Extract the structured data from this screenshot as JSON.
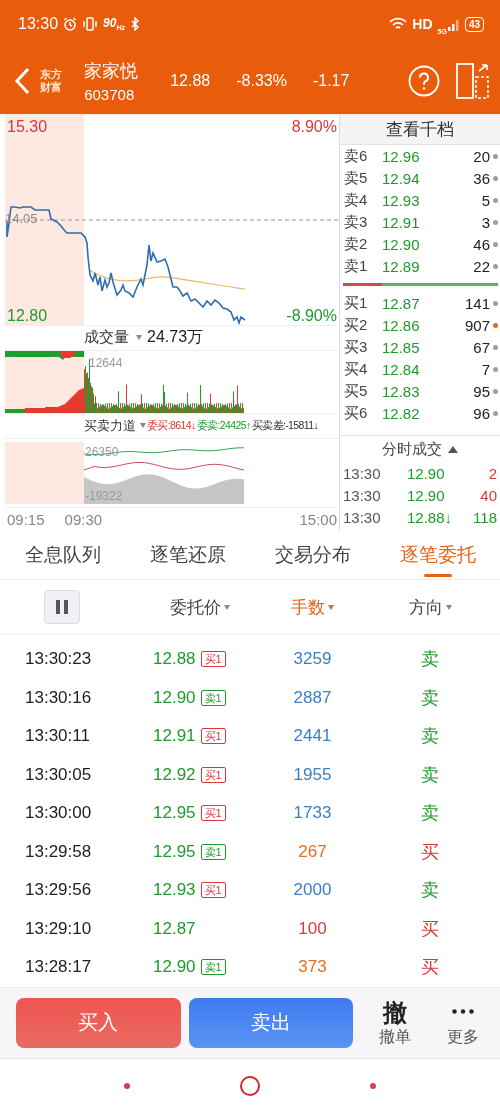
{
  "status_bar": {
    "time": "13:30",
    "refresh": "90$_{Hz}$",
    "hd": "HD",
    "network": "5G",
    "battery": "43"
  },
  "header": {
    "logo": "东方财富",
    "name": "家家悦",
    "code": "603708",
    "price": "12.88",
    "change_pct": "-8.33%",
    "change": "-1.17"
  },
  "price_chart": {
    "high": "15.30",
    "high_pct": "8.90%",
    "base": "14.05",
    "low": "12.80",
    "low_pct": "-8.90%"
  },
  "volume_chart": {
    "label": "成交量",
    "total": "24.73万",
    "max": "12644"
  },
  "force_chart": {
    "label": "买卖力道",
    "bid": "委买:8614↓",
    "ask": "委卖:24425↑",
    "diff": "买卖差:-15811↓",
    "max": "26350",
    "min": "-19322"
  },
  "time_axis": [
    "09:15",
    "09:30",
    "15:00"
  ],
  "order_book": {
    "button": "查看千档",
    "asks": [
      {
        "label": "卖6",
        "price": "12.96",
        "volume": "20",
        "color": "#9e9e9e"
      },
      {
        "label": "卖5",
        "price": "12.94",
        "volume": "36",
        "color": "#9e9e9e"
      },
      {
        "label": "卖4",
        "price": "12.93",
        "volume": "5",
        "color": "#9e9e9e"
      },
      {
        "label": "卖3",
        "price": "12.91",
        "volume": "3",
        "color": "#9e9e9e"
      },
      {
        "label": "卖2",
        "price": "12.90",
        "volume": "46",
        "color": "#9e9e9e"
      },
      {
        "label": "卖1",
        "price": "12.89",
        "volume": "22",
        "color": "#9e9e9e"
      }
    ],
    "ratio": {
      "level": 0.25
    },
    "bids": [
      {
        "label": "买1",
        "price": "12.87",
        "volume": "141",
        "color": "#9e9e9e"
      },
      {
        "label": "买2",
        "price": "12.86",
        "volume": "907",
        "color": "#e8661e"
      },
      {
        "label": "买3",
        "price": "12.85",
        "volume": "67",
        "color": "#9e9e9e"
      },
      {
        "label": "买4",
        "price": "12.84",
        "volume": "7",
        "color": "#9e9e9e"
      },
      {
        "label": "买5",
        "price": "12.83",
        "volume": "95",
        "color": "#9e9e9e"
      },
      {
        "label": "买6",
        "price": "12.82",
        "volume": "96",
        "color": "#9e9e9e"
      }
    ]
  },
  "ticks": {
    "title": "分时成交",
    "rows": [
      {
        "time": "13:30",
        "price": "12.90",
        "volume": "2",
        "kind": "buy"
      },
      {
        "time": "13:30",
        "price": "12.90",
        "volume": "40",
        "kind": "buy"
      },
      {
        "time": "13:30",
        "price": "12.88↓",
        "volume": "118",
        "kind": "sell"
      }
    ]
  },
  "tabs": [
    {
      "label": "全息队列",
      "selected": false
    },
    {
      "label": "逐笔还原",
      "selected": false
    },
    {
      "label": "交易分布",
      "selected": false
    },
    {
      "label": "逐笔委托",
      "selected": true
    }
  ],
  "columns": [
    {
      "label": "委托价",
      "selected": false
    },
    {
      "label": "手数",
      "selected": true
    },
    {
      "label": "方向",
      "selected": false
    }
  ],
  "orders": [
    {
      "time": "13:30:23",
      "price": "12.88",
      "tag": {
        "text": "买1",
        "kind": "buy"
      },
      "volume": "3259",
      "color": "#3b7fc4",
      "direction": "卖",
      "kind": "sell"
    },
    {
      "time": "13:30:16",
      "price": "12.90",
      "tag": {
        "text": "卖1",
        "kind": "sell"
      },
      "volume": "2887",
      "color": "#3b7fc4",
      "direction": "卖",
      "kind": "sell"
    },
    {
      "time": "13:30:11",
      "price": "12.91",
      "tag": {
        "text": "买1",
        "kind": "buy"
      },
      "volume": "2441",
      "color": "#3b7fc4",
      "direction": "卖",
      "kind": "sell"
    },
    {
      "time": "13:30:05",
      "price": "12.92",
      "tag": {
        "text": "买1",
        "kind": "buy"
      },
      "volume": "1955",
      "color": "#3b7fc4",
      "direction": "卖",
      "kind": "sell"
    },
    {
      "time": "13:30:00",
      "price": "12.95",
      "tag": {
        "text": "买1",
        "kind": "buy"
      },
      "volume": "1733",
      "color": "#3b7fc4",
      "direction": "卖",
      "kind": "sell"
    },
    {
      "time": "13:29:58",
      "price": "12.95",
      "tag": {
        "text": "卖1",
        "kind": "sell"
      },
      "volume": "267",
      "color": "#e0701e",
      "direction": "买",
      "kind": "buy"
    },
    {
      "time": "13:29:56",
      "price": "12.93",
      "tag": {
        "text": "买1",
        "kind": "buy"
      },
      "volume": "2000",
      "color": "#3b7fc4",
      "direction": "卖",
      "kind": "sell"
    },
    {
      "time": "13:29:10",
      "price": "12.87",
      "volume": "100",
      "color": "#e03a3a",
      "direction": "买",
      "kind": "buy"
    },
    {
      "time": "13:28:17",
      "price": "12.90",
      "tag": {
        "text": "卖1",
        "kind": "sell"
      },
      "volume": "373",
      "color": "#e0701e",
      "direction": "买",
      "kind": "buy"
    }
  ],
  "actions": {
    "buy": "买入",
    "sell": "卖出",
    "cancel_icon": "撤",
    "cancel": "撤单",
    "more": "更多"
  }
}
